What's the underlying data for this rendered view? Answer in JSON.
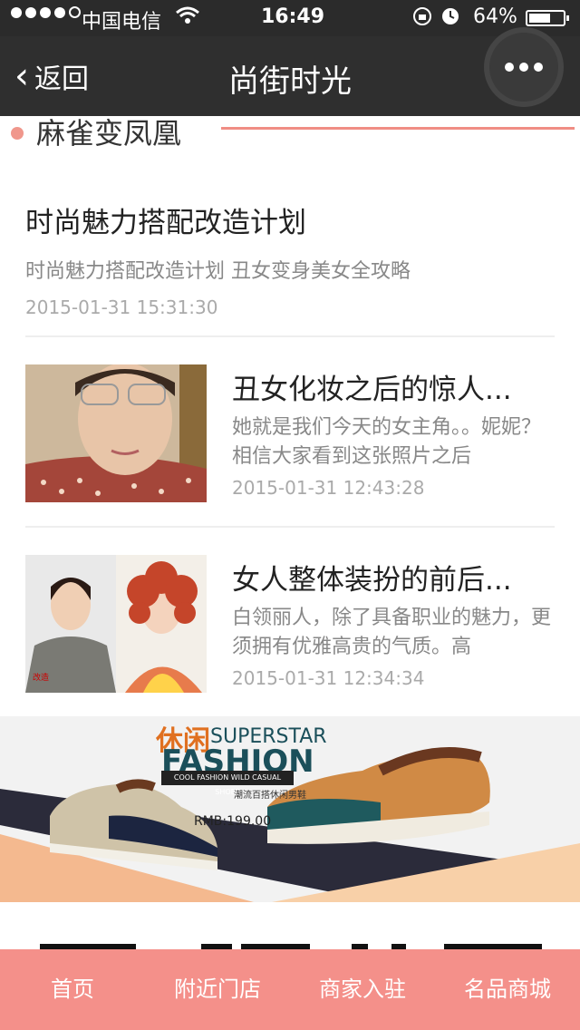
{
  "status_bar": {
    "carrier": "中国电信",
    "time": "16:49",
    "battery": "64%",
    "battery_fraction": 0.64
  },
  "nav": {
    "back_label": "返回",
    "title": "尚街时光"
  },
  "section": {
    "title": "麻雀变凤凰"
  },
  "top_article": {
    "title": "时尚魅力搭配改造计划",
    "desc": "时尚魅力搭配改造计划 丑女变身美女全攻略",
    "date": "2015-01-31 15:31:30"
  },
  "articles": [
    {
      "title": "丑女化妆之后的惊人...",
      "desc": "她就是我们今天的女主角。。妮妮？ 相信大家看到这张照片之后",
      "date": "2015-01-31 12:43:28"
    },
    {
      "title": "女人整体装扮的前后...",
      "desc": "白领丽人，除了具备职业的魅力，更须拥有优雅高贵的气质。高",
      "date": "2015-01-31 12:34:34"
    }
  ],
  "banner": {
    "xiuxian": "休闲",
    "superstar": "SUPERSTAR",
    "fashion": "FASHION",
    "bar_text": "COOL FASHION WILD CASUAL SHOES",
    "sub": "潮流百搭休闲男鞋",
    "price": "RMB:199.00"
  },
  "tabs": [
    "首页",
    "附近门店",
    "商家入驻",
    "名品商城"
  ],
  "colors": {
    "accent": "#f4908a",
    "nav_bg": "#2f2f2f"
  }
}
